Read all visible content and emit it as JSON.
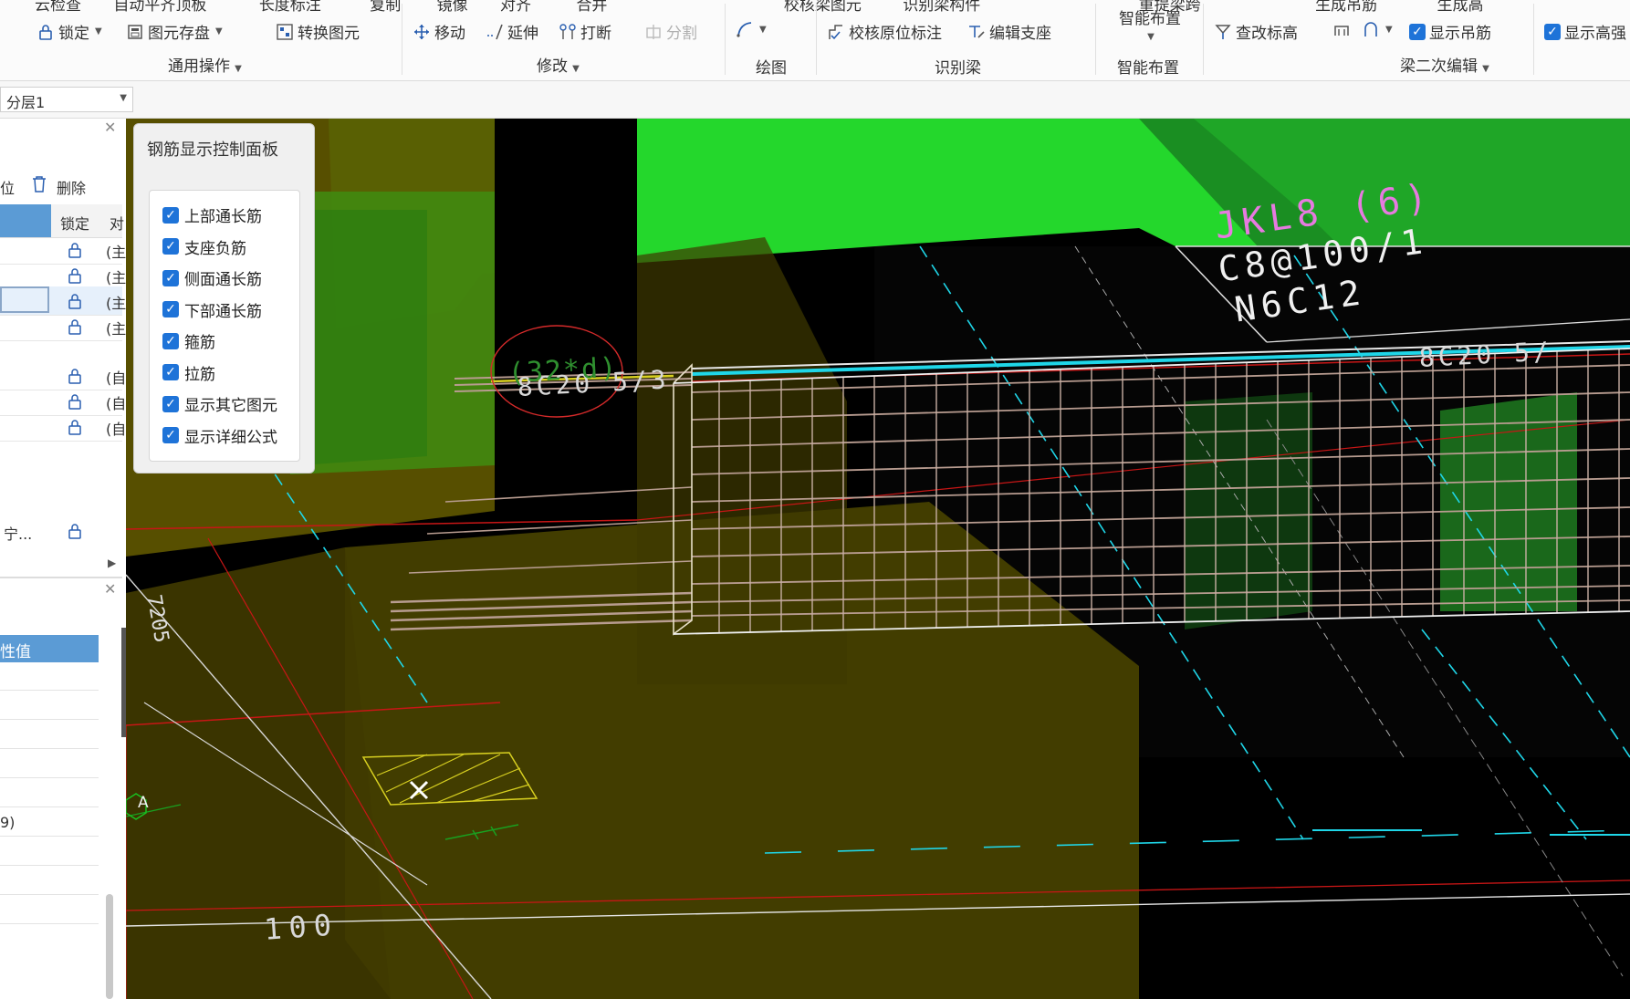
{
  "ribbon": {
    "top_row_partial": [
      "云检查",
      "自动平齐顶板",
      "长度标注",
      "复制",
      "镜像",
      "对齐",
      "合并",
      "校核梁图元",
      "识别梁构件",
      "重提梁跨",
      "生成吊筋",
      "生成高"
    ],
    "general_ops": {
      "lock": "锁定",
      "save_elements": "图元存盘",
      "convert_elements": "转换图元",
      "group_label": "通用操作"
    },
    "modify": {
      "move": "移动",
      "extend": "延伸",
      "break": "打断",
      "split": "分割",
      "group_label": "修改"
    },
    "draw": {
      "group_label": "绘图"
    },
    "identify_beam": {
      "check_annotation": "校核原位标注",
      "edit_support": "编辑支座",
      "group_label": "识别梁"
    },
    "smart_layout": {
      "button_label": "智能布置",
      "group_label": "智能布置"
    },
    "beam_secondary_edit": {
      "check_elevation": "查改标高",
      "show_hanger": "显示吊筋",
      "show_high_strength": "显示高强",
      "group_label": "梁二次编辑"
    }
  },
  "layer_select": {
    "value": "分层1"
  },
  "left_panel": {
    "toolbar": {
      "position_partial": "位",
      "delete": "删除"
    },
    "header": {
      "lock": "锁定",
      "col3_partial": "对"
    },
    "rows": [
      {
        "suffix": "(主"
      },
      {
        "suffix": "(主"
      },
      {
        "suffix": "(主"
      },
      {
        "suffix": "(主"
      },
      {
        "suffix": "(自"
      },
      {
        "suffix": "(自"
      },
      {
        "suffix": "(自"
      }
    ],
    "truncated_row": "宁...",
    "prop_header": "性值",
    "prop_value_partial": "9)"
  },
  "rebar_panel": {
    "title": "钢筋显示控制面板",
    "options": [
      {
        "label": "上部通长筋",
        "checked": true
      },
      {
        "label": "支座负筋",
        "checked": true
      },
      {
        "label": "侧面通长筋",
        "checked": true
      },
      {
        "label": "下部通长筋",
        "checked": true
      },
      {
        "label": "箍筋",
        "checked": true
      },
      {
        "label": "拉筋",
        "checked": true
      },
      {
        "label": "显示其它图元",
        "checked": true
      },
      {
        "label": "显示详细公式",
        "checked": true
      }
    ]
  },
  "viewport": {
    "beam_name": "JKL8 (6)",
    "stirrup": "C8@100/1",
    "side_bar": "N6C12",
    "top_bar_left": "8C20 5/3",
    "top_bar_right": "8C20 5/",
    "anchor_formula": "(32*d)",
    "dim_100": "100",
    "axis_label": "A",
    "colors": {
      "green_slab": "#22d32a",
      "column_olive": "#6b6000",
      "rebar": "#b89c90",
      "cyan_line": "#1fd6e8"
    }
  }
}
